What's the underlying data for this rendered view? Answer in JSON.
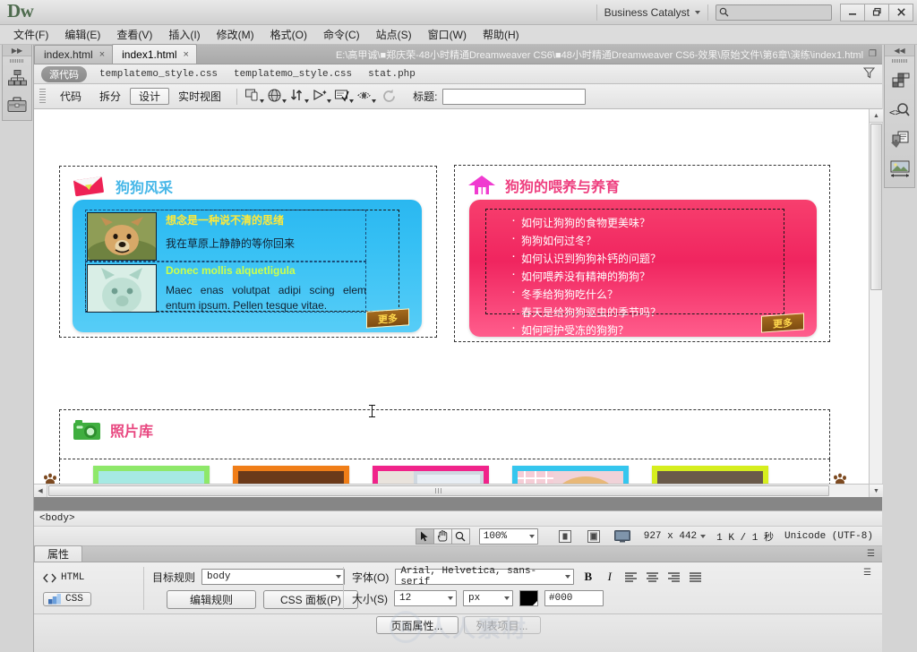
{
  "app": {
    "logo": "Dw",
    "workspace_label": "Business Catalyst",
    "search_placeholder": "",
    "window_minimize": "–",
    "window_restore": "❐",
    "window_close": "×"
  },
  "menubar": {
    "items": [
      {
        "label": "文件(F)"
      },
      {
        "label": "编辑(E)"
      },
      {
        "label": "查看(V)"
      },
      {
        "label": "插入(I)"
      },
      {
        "label": "修改(M)"
      },
      {
        "label": "格式(O)"
      },
      {
        "label": "命令(C)"
      },
      {
        "label": "站点(S)"
      },
      {
        "label": "窗口(W)"
      },
      {
        "label": "帮助(H)"
      }
    ]
  },
  "doctabs": {
    "tabs": [
      {
        "label": "index.html",
        "close": "×",
        "active": false
      },
      {
        "label": "index1.html",
        "close": "×",
        "active": true
      }
    ],
    "path": "E:\\高甲诚\\■郑庆荣-48小时精通Dreamweaver CS6\\■48小时精通Dreamweaver CS6-效果\\原始文件\\第6章\\演练\\index1.html"
  },
  "related_files": {
    "source_label": "源代码",
    "files": [
      "templatemo_style.css",
      "templatemo_style.css",
      "stat.php"
    ]
  },
  "viewbar": {
    "code_label": "代码",
    "split_label": "拆分",
    "design_label": "设计",
    "live_label": "实时视图",
    "title_label": "标题:",
    "title_value": ""
  },
  "page": {
    "news_panel": {
      "heading": "狗狗风采",
      "item1_title": "想念是一种说不清的思绪",
      "item1_body": "我在草原上静静的等你回来",
      "item2_title": "Donec mollis alquetligula",
      "item2_body": "Maec enas volutpat adipi scing elem entum ipsum. Pellen tesque vitae.",
      "more_label": "更多"
    },
    "faq_panel": {
      "heading": "狗狗的喂养与养育",
      "items": [
        "如何让狗狗的食物更美味？",
        "狗狗如何过冬？",
        "如何认识到狗狗补钙的问题？",
        "如何喂养没有精神的狗狗？",
        "冬季给狗狗吃什么？",
        "春天是给狗狗驱虫的季节吗？",
        "如何呵护受冻的狗狗？"
      ],
      "more_label": "更多"
    },
    "gallery_panel": {
      "heading": "照片库",
      "thumbs": [
        {
          "border": "#8ee86a",
          "fill": "#9fe8e0"
        },
        {
          "border": "#f07e18",
          "fill": "#6b3a1a"
        },
        {
          "border": "#f0238a",
          "fill": "#d9b9a8"
        },
        {
          "border": "#35c6ee",
          "fill": "#e8c69a"
        },
        {
          "border": "#d6ee1e",
          "fill": "#efefef"
        }
      ]
    }
  },
  "tagbar": {
    "tag": "<body>"
  },
  "statusbar": {
    "select_icon": "select-arrow",
    "hand_icon": "hand",
    "zoom_icon": "magnifier",
    "zoom_value": "100%",
    "window_sizes": [
      "phone",
      "tablet",
      "desktop"
    ],
    "dimensions": "927 x 442",
    "filesize": "1 K / 1 秒",
    "encoding": "Unicode (UTF-8)"
  },
  "properties": {
    "tab_label": "属性",
    "html_label": "HTML",
    "css_label": "CSS",
    "target_rule_label": "目标规则",
    "target_rule_value": "body",
    "edit_rule_label": "编辑规则",
    "css_panel_label": "CSS 面板(P)",
    "font_label": "字体(O)",
    "font_value": "Arial, Helvetica, sans-serif",
    "size_label": "大小(S)",
    "size_value": "12",
    "size_unit": "px",
    "color_swatch": "#000000",
    "color_value": "#000",
    "bold_label": "B",
    "italic_label": "I",
    "align_left": "align-left",
    "align_center": "align-center",
    "align_right": "align-right",
    "align_justify": "align-justify",
    "page_properties_label": "页面属性...",
    "list_item_label": "列表项目..."
  },
  "panels": {
    "left": [
      {
        "icon": "site-hierarchy-icon"
      },
      {
        "icon": "briefcase-icon"
      }
    ],
    "right": [
      {
        "icon": "css-styles-icon"
      },
      {
        "icon": "code-navigator-icon"
      },
      {
        "icon": "insert-panel-icon"
      },
      {
        "icon": "image-size-icon"
      }
    ]
  },
  "watermark": {
    "mark": "R",
    "text": "人人素材"
  }
}
